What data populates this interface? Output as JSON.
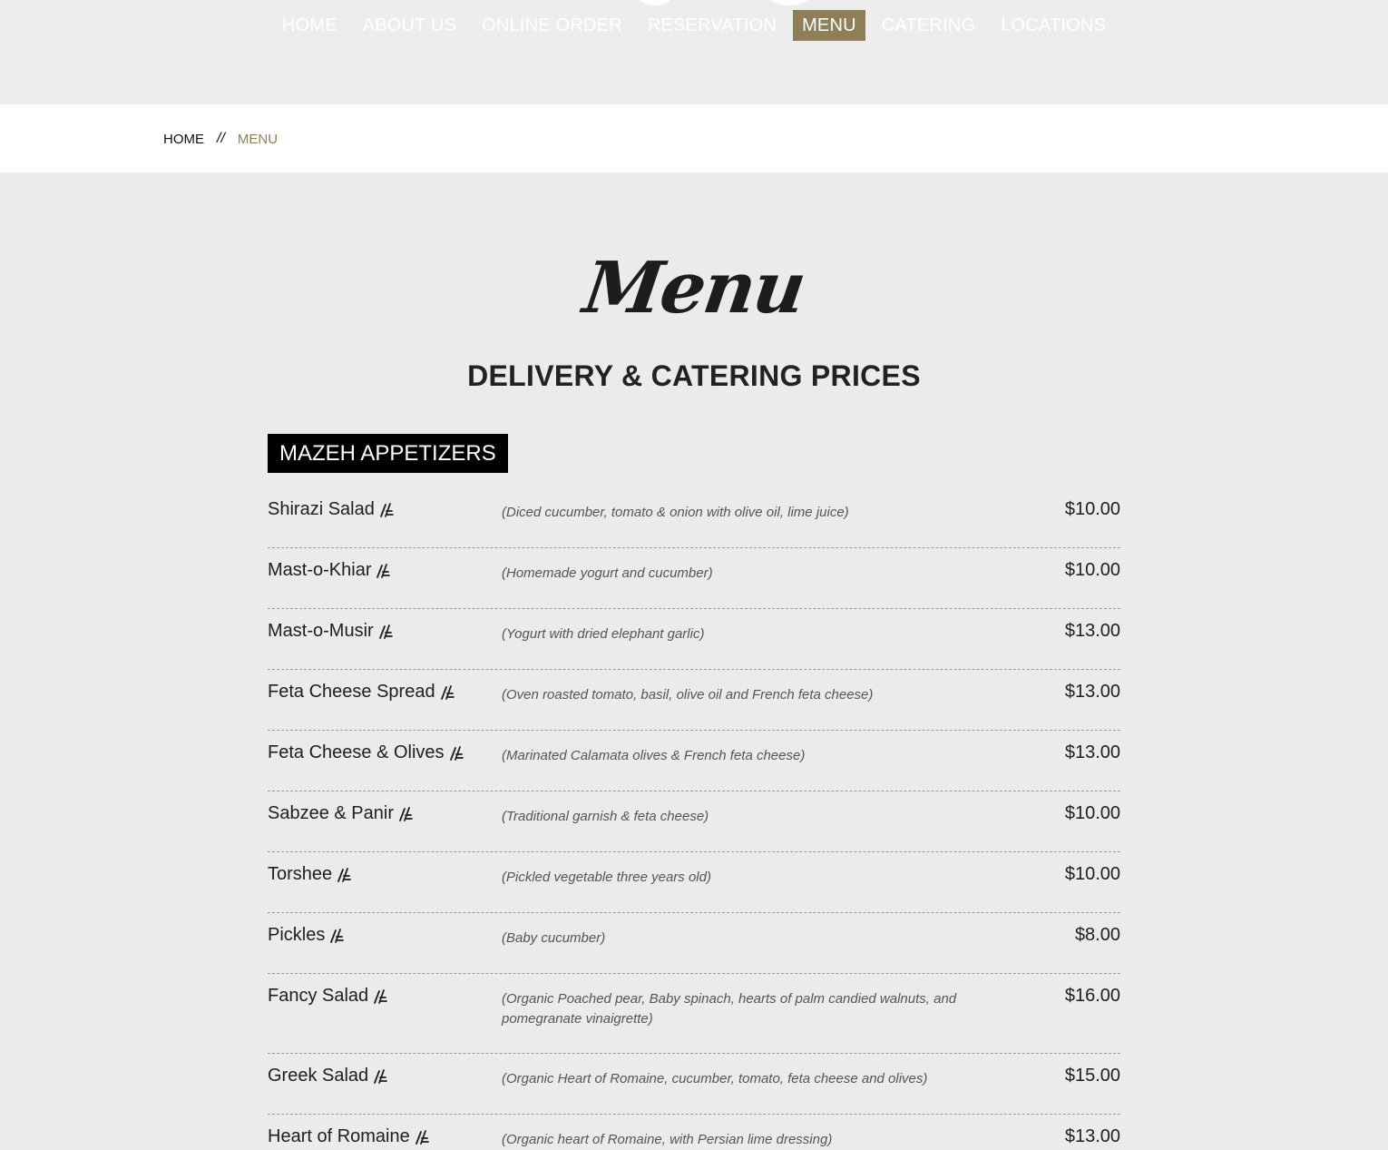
{
  "nav": {
    "items": [
      {
        "label": "HOME",
        "active": false
      },
      {
        "label": "ABOUT US",
        "active": false
      },
      {
        "label": "ONLINE ORDER",
        "active": false
      },
      {
        "label": "RESERVATION",
        "active": false
      },
      {
        "label": "MENU",
        "active": true
      },
      {
        "label": "CATERING",
        "active": false
      },
      {
        "label": "LOCATIONS",
        "active": false
      }
    ]
  },
  "breadcrumb": {
    "home": "HOME",
    "separator": "//",
    "current": "MENU"
  },
  "page": {
    "title": "Menu",
    "subtitle": "DELIVERY & CATERING PRICES",
    "section": "MAZEH APPETIZERS"
  },
  "menu_items": [
    {
      "name": "Shirazi Salad",
      "desc": "(Diced cucumber, tomato & onion with olive oil, lime juice)",
      "price": "$10.00",
      "icon": "vegetarian-icon"
    },
    {
      "name": "Mast-o-Khiar",
      "desc": "(Homemade yogurt and cucumber)",
      "price": "$10.00",
      "icon": "vegetarian-icon"
    },
    {
      "name": "Mast-o-Musir",
      "desc": "(Yogurt with dried elephant garlic)",
      "price": "$13.00",
      "icon": "vegetarian-icon"
    },
    {
      "name": "Feta Cheese Spread",
      "desc": "(Oven roasted tomato, basil, olive oil and French feta cheese)",
      "price": "$13.00",
      "icon": "vegetarian-icon"
    },
    {
      "name": "Feta Cheese & Olives",
      "desc": "(Marinated Calamata olives & French feta cheese)",
      "price": "$13.00",
      "icon": "vegetarian-icon"
    },
    {
      "name": "Sabzee & Panir",
      "desc": "(Traditional garnish & feta cheese)",
      "price": "$10.00",
      "icon": "vegetarian-icon"
    },
    {
      "name": "Torshee",
      "desc": "(Pickled vegetable three years old)",
      "price": "$10.00",
      "icon": "vegetarian-icon"
    },
    {
      "name": "Pickles",
      "desc": "(Baby cucumber)",
      "price": "$8.00",
      "icon": "vegetarian-icon"
    },
    {
      "name": "Fancy Salad",
      "desc": "(Organic Poached pear, Baby spinach, hearts of palm candied walnuts, and pomegranate vinaigrette)",
      "price": "$16.00",
      "icon": "vegetarian-icon"
    },
    {
      "name": "Greek Salad",
      "desc": "(Organic Heart of Romaine, cucumber, tomato, feta cheese and olives)",
      "price": "$15.00",
      "icon": "vegetarian-icon"
    },
    {
      "name": "Heart of Romaine",
      "desc": "(Organic heart of Romaine, with Persian lime dressing)",
      "price": "$13.00",
      "icon": "vegetarian-icon"
    }
  ],
  "colors": {
    "accent": "#8f7f56",
    "background": "#ebebeb",
    "section_label_bg": "#000000"
  }
}
